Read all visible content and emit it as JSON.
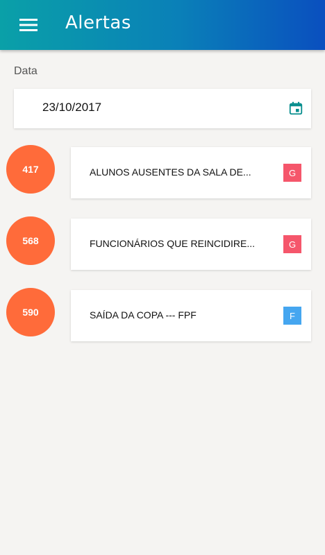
{
  "appbar": {
    "title": "Alertas",
    "menu_icon": "hamburger-menu-icon",
    "gradient": [
      "#0aa0a8",
      "#0a4fbf"
    ]
  },
  "filter": {
    "label": "Data",
    "date_value": "23/10/2017",
    "calendar_icon": "calendar-icon",
    "calendar_icon_color": "#0a8f8f"
  },
  "alerts": [
    {
      "id": "417",
      "title": "ALUNOS AUSENTES DA SALA DE...",
      "badge": "G",
      "badge_color": "#f5566b"
    },
    {
      "id": "568",
      "title": "FUNCIONÁRIOS QUE REINCIDIRE...",
      "badge": "G",
      "badge_color": "#f5566b"
    },
    {
      "id": "590",
      "title": "SAÍDA DA COPA --- FPF",
      "badge": "F",
      "badge_color": "#45a6f0"
    }
  ],
  "colors": {
    "circle": "#ff6b3a",
    "background": "#f5f4f2"
  }
}
